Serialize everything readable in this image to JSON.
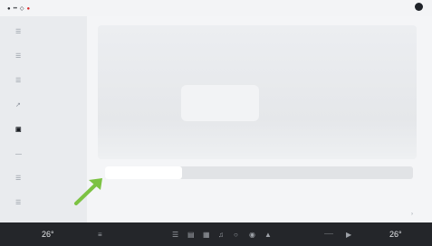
{
  "status_bar": {
    "items": [
      "●",
      "••",
      "◇"
    ],
    "alert": "●",
    "profile_icon": "profile-circle-icon"
  },
  "sidebar": {
    "items": [
      {
        "label": "",
        "icon": "☰"
      },
      {
        "label": "",
        "icon": "☰"
      },
      {
        "label": "",
        "icon": "☰"
      },
      {
        "label": "",
        "icon": "↗"
      },
      {
        "label": "",
        "icon": "▣"
      },
      {
        "label": "",
        "icon": "—"
      },
      {
        "label": "",
        "icon": "☰"
      },
      {
        "label": "",
        "icon": "☰"
      }
    ],
    "active_index": 4
  },
  "main": {
    "suspension": {
      "label": "",
      "options": [
        "",
        "",
        "",
        ""
      ],
      "selected_index": 0
    },
    "list_item": {
      "label": "",
      "chevron": "›"
    }
  },
  "bottom_bar": {
    "left_temp": "26°",
    "right_temp": "26°",
    "icons": [
      "≡",
      "☰",
      "▤",
      "▦",
      "♫",
      "○",
      "◉",
      "▲",
      "▶"
    ],
    "center_text": "——"
  },
  "colors": {
    "accent_arrow": "#7cc243",
    "bottom_bar": "#24262a",
    "status_alert": "#d92b2b"
  }
}
